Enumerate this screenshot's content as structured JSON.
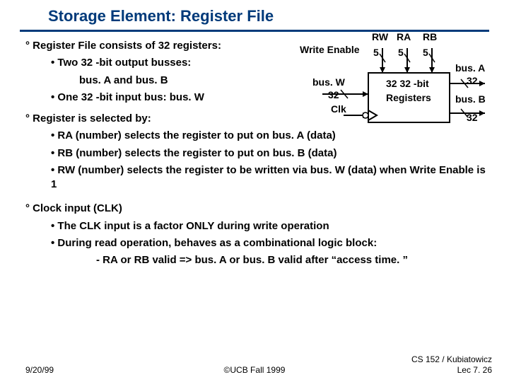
{
  "title": "Storage Element: Register File",
  "bullets": {
    "b1": "Register File consists of 32 registers:",
    "b1_1": "Two 32 -bit output busses:",
    "b1_1a": "bus. A and bus. B",
    "b1_2": "One 32 -bit input bus: bus. W",
    "b2": "Register is selected by:",
    "b2_1": "RA (number) selects the register to put on bus. A (data)",
    "b2_2": "RB (number) selects the register to put on bus. B (data)",
    "b2_3": "RW (number) selects the register to be  written via bus. W (data) when Write Enable is 1",
    "b3": "Clock input (CLK)",
    "b3_1": "The CLK input is a factor ONLY during write operation",
    "b3_2": "During read operation, behaves as a combinational logic block:",
    "b3_2a": "RA or RB valid => bus. A or bus. B valid after “access time. ”"
  },
  "diagram": {
    "rw": "RW",
    "ra": "RA",
    "rb": "RB",
    "we": "Write Enable",
    "five1": "5",
    "five2": "5",
    "five3": "5",
    "busw": "bus. W",
    "busw32": "32",
    "clk": "Clk",
    "box1": "32 32 -bit",
    "box2": "Registers",
    "busa": "bus. A",
    "busa32": "32",
    "busb": "bus. B",
    "busb32": "32"
  },
  "footer": {
    "date": "9/20/99",
    "center": "©UCB Fall 1999",
    "right1": "CS 152 / Kubiatowicz",
    "right2": "Lec 7. 26"
  }
}
